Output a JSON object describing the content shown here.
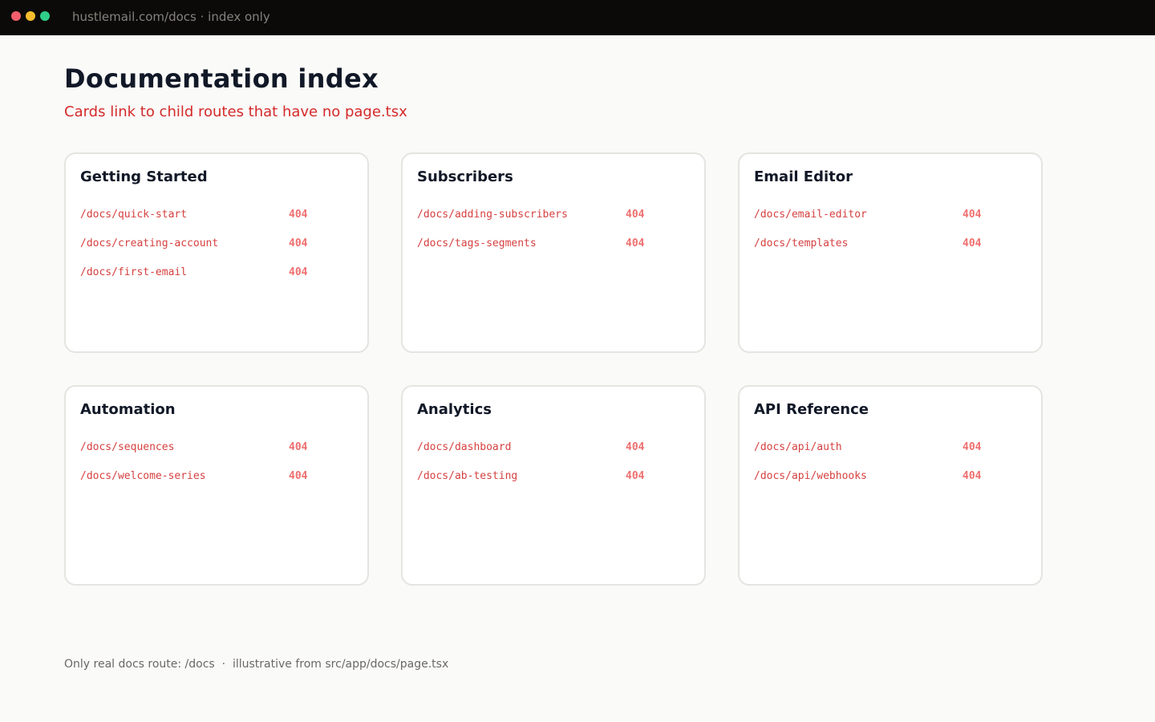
{
  "window": {
    "address": "hustlemail.com/docs · index only",
    "colors": {
      "close": "#f05f69",
      "minimize": "#f5bd2d",
      "maximize": "#2fcf8a"
    }
  },
  "header": {
    "title": "Documentation index",
    "subtitle": "Cards link to child routes that have no page.tsx"
  },
  "cards": [
    {
      "title": "Getting Started",
      "links": [
        {
          "route": "/docs/quick-start",
          "status": "404"
        },
        {
          "route": "/docs/creating-account",
          "status": "404"
        },
        {
          "route": "/docs/first-email",
          "status": "404"
        }
      ]
    },
    {
      "title": "Subscribers",
      "links": [
        {
          "route": "/docs/adding-subscribers",
          "status": "404"
        },
        {
          "route": "/docs/tags-segments",
          "status": "404"
        }
      ]
    },
    {
      "title": "Email Editor",
      "links": [
        {
          "route": "/docs/email-editor",
          "status": "404"
        },
        {
          "route": "/docs/templates",
          "status": "404"
        }
      ]
    },
    {
      "title": "Automation",
      "links": [
        {
          "route": "/docs/sequences",
          "status": "404"
        },
        {
          "route": "/docs/welcome-series",
          "status": "404"
        }
      ]
    },
    {
      "title": "Analytics",
      "links": [
        {
          "route": "/docs/dashboard",
          "status": "404"
        },
        {
          "route": "/docs/ab-testing",
          "status": "404"
        }
      ]
    },
    {
      "title": "API Reference",
      "links": [
        {
          "route": "/docs/api/auth",
          "status": "404"
        },
        {
          "route": "/docs/api/webhooks",
          "status": "404"
        }
      ]
    }
  ],
  "footer": {
    "text": "Only real docs route: /docs  ·  illustrative from src/app/docs/page.tsx"
  }
}
